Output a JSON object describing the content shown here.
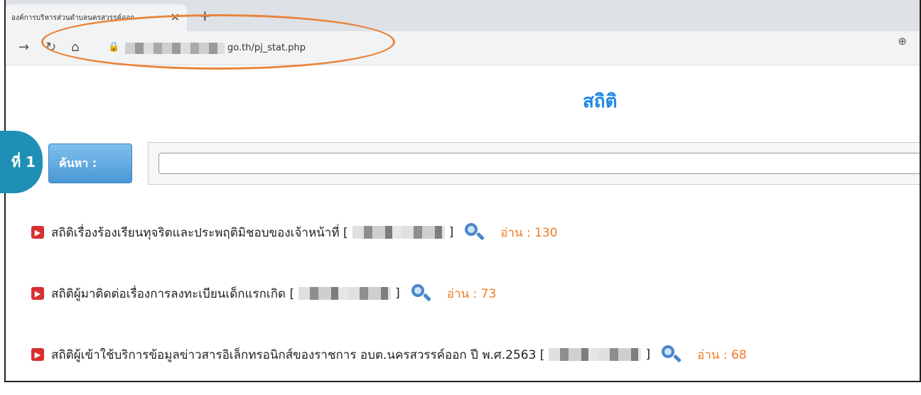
{
  "browser": {
    "tab_title": "องค์การบริหารส่วนตำบลนครสวรรค์ออก",
    "tab_close": "×",
    "new_tab": "+",
    "url": "go.th/pj_stat.php"
  },
  "page": {
    "title": "สถิติ",
    "badge": "ที่ 1",
    "search_button": "ค้นหา :"
  },
  "stats": [
    {
      "text": "สถิติเรื่องร้องเรียนทุจริตและประพฤติมิชอบของเจ้าหน้าที่ [",
      "close": "]",
      "read": "อ่าน : 130"
    },
    {
      "text": "สถิติผู้มาติดต่อเรื่องการลงทะเบียนเด็กแรกเกิด [",
      "close": "]",
      "read": "อ่าน : 73"
    },
    {
      "text": "สถิติผู้เข้าใช้บริการข้อมูลข่าวสารอิเล็กทรอนิกส์ของราชการ อบต.นครสวรรค์ออก ปี พ.ศ.2563 [",
      "close": "]",
      "read": "อ่าน : 68"
    }
  ],
  "colors": {
    "accent": "#1e88e5",
    "read": "#f07a24",
    "highlight": "#e9843a"
  },
  "icons": [
    "back-icon",
    "reload-icon",
    "home-icon",
    "lock-icon",
    "zoom-icon",
    "magnifier-icon",
    "bullet-arrow-icon"
  ]
}
